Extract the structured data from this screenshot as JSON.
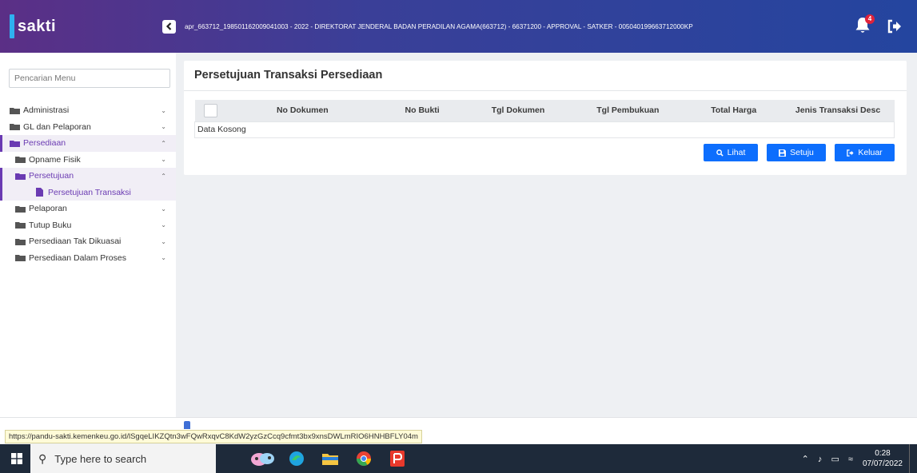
{
  "header": {
    "brand": "sakti",
    "context": "apr_663712_198501162009041003 - 2022 - DIREKTORAT JENDERAL BADAN PERADILAN AGAMA(663712) - 66371200 - APPROVAL - SATKER - 005040199663712000KP",
    "notification_count": "4",
    "toggle_icon": "chevron-left-icon",
    "logout_icon": "sign-out-icon"
  },
  "sidebar": {
    "search_placeholder": "Pencarian Menu",
    "items": [
      {
        "label": "Administrasi"
      },
      {
        "label": "GL dan Pelaporan"
      },
      {
        "label": "Persediaan"
      },
      {
        "label": "Opname Fisik"
      },
      {
        "label": "Persetujuan"
      },
      {
        "label": "Persetujuan Transaksi"
      },
      {
        "label": "Pelaporan"
      },
      {
        "label": "Tutup Buku"
      },
      {
        "label": "Persediaan Tak Dikuasai"
      },
      {
        "label": "Persediaan Dalam Proses"
      }
    ]
  },
  "main": {
    "title": "Persetujuan Transaksi Persediaan",
    "columns": [
      "No Dokumen",
      "No Bukti",
      "Tgl Dokumen",
      "Tgl Pembukuan",
      "Total Harga",
      "Jenis Transaksi Desc"
    ],
    "empty_text": "Data Kosong",
    "buttons": {
      "lihat": "Lihat",
      "setuju": "Setuju",
      "keluar": "Keluar"
    }
  },
  "status_url": "https://pandu-sakti.kemenkeu.go.id/lSgqeLIKZQtn3wFQwRxqvC8KdW2yzGzCcq9cfmt3bx9xnsDWLmRIO6HNHBFLY04m",
  "taskbar": {
    "search_placeholder": "Type here to search",
    "time": "0:28",
    "date": "07/07/2022"
  },
  "colors": {
    "accent": "#6a3ab2",
    "primary_button": "#0d6efd",
    "header_start": "#5b2f86",
    "header_end": "#24459f"
  }
}
